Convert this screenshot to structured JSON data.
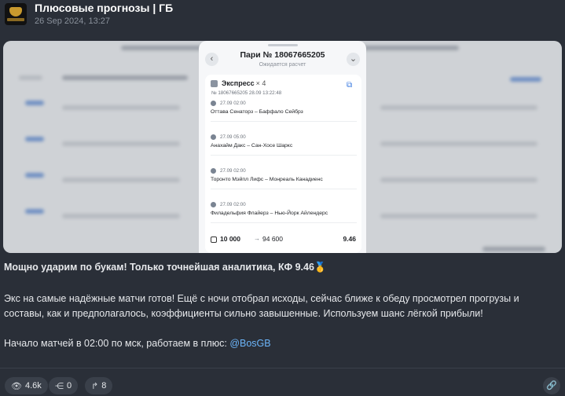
{
  "header": {
    "channel_name": "Плюсовые прогнозы | ГБ",
    "date": "26 Sep 2024, 13:27"
  },
  "bet": {
    "title": "Пари № 18067665205",
    "status": "Ожидается расчет",
    "type": "Экспресс",
    "count": "× 4",
    "meta": "№ 18067665205   28.09   13:22:48",
    "events": [
      {
        "time": "27.09   02:00",
        "match": "Оттава Сенаторз – Баффало Сейбрз"
      },
      {
        "time": "27.09   05:00",
        "match": "Анахайм Дакс – Сан-Хосе Шаркс"
      },
      {
        "time": "27.09   02:00",
        "match": "Торонто Мэйпл Лифс – Монреаль Канадиенс"
      },
      {
        "time": "27.09   02:00",
        "match": "Филадельфия Флайерз – Нью-Йорк Айлендерс"
      }
    ],
    "stake": "10 000",
    "payout": "94 600",
    "coefficient": "9.46"
  },
  "caption": {
    "line1": "Мощно ударим по букам! Только точнейшая аналитика, КФ 9.46🥇",
    "line2": "Экс на самые надёжные матчи готов! Ещё с ночи отобрал исходы, сейчас ближе к обеду просмотрел прогрузы и",
    "line3": "составы, как и предполагалось, коэффициенты сильно завышенные. Используем шанс лёгкой прибыли!",
    "line4_prefix": "Начало матчей в 02:00 по мск, работаем в плюс: ",
    "mention": "@BosGB"
  },
  "footer": {
    "views": "4.6k",
    "reactions": "0",
    "shares": "8"
  },
  "icons": {
    "views": "eye-icon",
    "reactions": "share-nodes-icon",
    "shares": "forward-icon",
    "link": "link-icon"
  }
}
